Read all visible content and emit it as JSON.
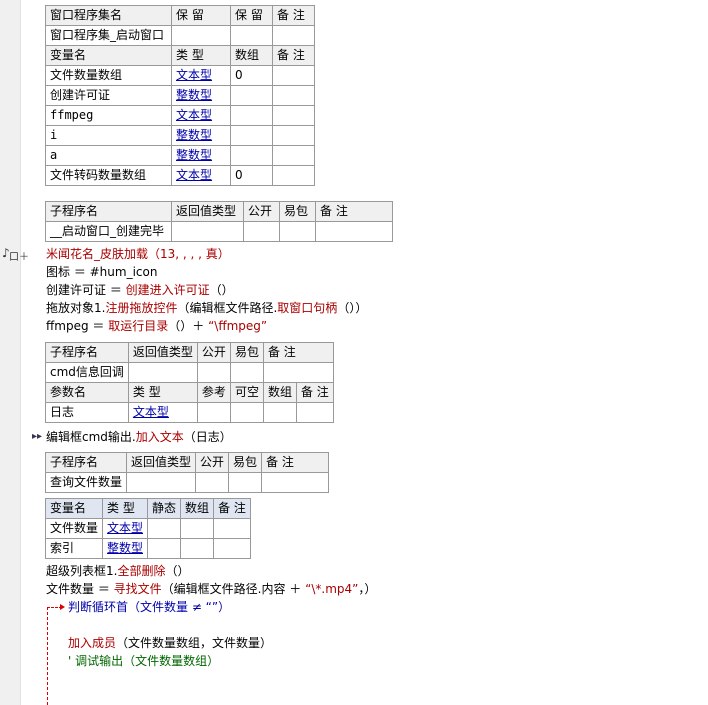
{
  "window_set": {
    "headers": [
      "窗口程序集名",
      "保 留",
      "保 留",
      "备 注"
    ],
    "name": "窗口程序集_启动窗口",
    "var_headers": [
      "变量名",
      "类 型",
      "数组",
      "备 注"
    ],
    "vars": [
      {
        "name": "文件数量数组",
        "type": "文本型",
        "array": "0"
      },
      {
        "name": "创建许可证",
        "type": "整数型",
        "array": ""
      },
      {
        "name": "ffmpeg",
        "type": "文本型",
        "array": ""
      },
      {
        "name": "i",
        "type": "整数型",
        "array": ""
      },
      {
        "name": "a",
        "type": "整数型",
        "array": ""
      },
      {
        "name": "文件转码数量数组",
        "type": "文本型",
        "array": "0"
      }
    ]
  },
  "sub1": {
    "headers": [
      "子程序名",
      "返回值类型",
      "公开",
      "易包",
      "备 注"
    ],
    "name": "__启动窗口_创建完毕"
  },
  "code1": {
    "l1_fn": "米闻花名_皮肤加载",
    "l1_args": "（13, , , , 真）",
    "l2": "图标 ＝ #hum_icon",
    "l3_a": "创建许可证 ＝ ",
    "l3_fn": "创建进入许可证",
    "l3_b": "（）",
    "l4_a": "拖放对象1.",
    "l4_fn": "注册拖放控件",
    "l4_b": "（编辑框文件路径.",
    "l4_fn2": "取窗口句柄",
    "l4_c": "（））",
    "l5_a": "ffmpeg ＝ ",
    "l5_fn": "取运行目录",
    "l5_b": "（）＋ ",
    "l5_str": "“\\ffmpeg”"
  },
  "sub2": {
    "headers": [
      "子程序名",
      "返回值类型",
      "公开",
      "易包",
      "备 注"
    ],
    "name": "cmd信息回调",
    "param_headers": [
      "参数名",
      "类 型",
      "参考",
      "可空",
      "数组",
      "备 注"
    ],
    "param_name": "日志",
    "param_type": "文本型"
  },
  "code2": {
    "a": "编辑框cmd输出.",
    "fn": "加入文本",
    "b": "（日志）"
  },
  "sub3": {
    "headers": [
      "子程序名",
      "返回值类型",
      "公开",
      "易包",
      "备 注"
    ],
    "name": "查询文件数量",
    "var_headers": [
      "变量名",
      "类 型",
      "静态",
      "数组",
      "备 注"
    ],
    "vars": [
      {
        "name": "文件数量",
        "type": "文本型"
      },
      {
        "name": "索引",
        "type": "整数型"
      }
    ]
  },
  "code3": {
    "l1_a": "超级列表框1.",
    "l1_fn": "全部删除",
    "l1_b": "（）",
    "l2_a": "文件数量 ＝ ",
    "l2_fn": "寻找文件",
    "l2_b": "（编辑框文件路径.",
    "l2_c": "内容 ＋ ",
    "l2_str": "“\\*.mp4”",
    "l2_d": "，）",
    "l3": "判断循环首（文件数量 ≠ “”）",
    "l4_fn": "加入成员",
    "l4_b": "（文件数量数组，文件数量）",
    "l5": "' 调试输出（文件数量数组）"
  },
  "markers": {
    "gutter_mark": "♪",
    "fold_mark": "口＋",
    "arrow_mark": "▸▸"
  }
}
